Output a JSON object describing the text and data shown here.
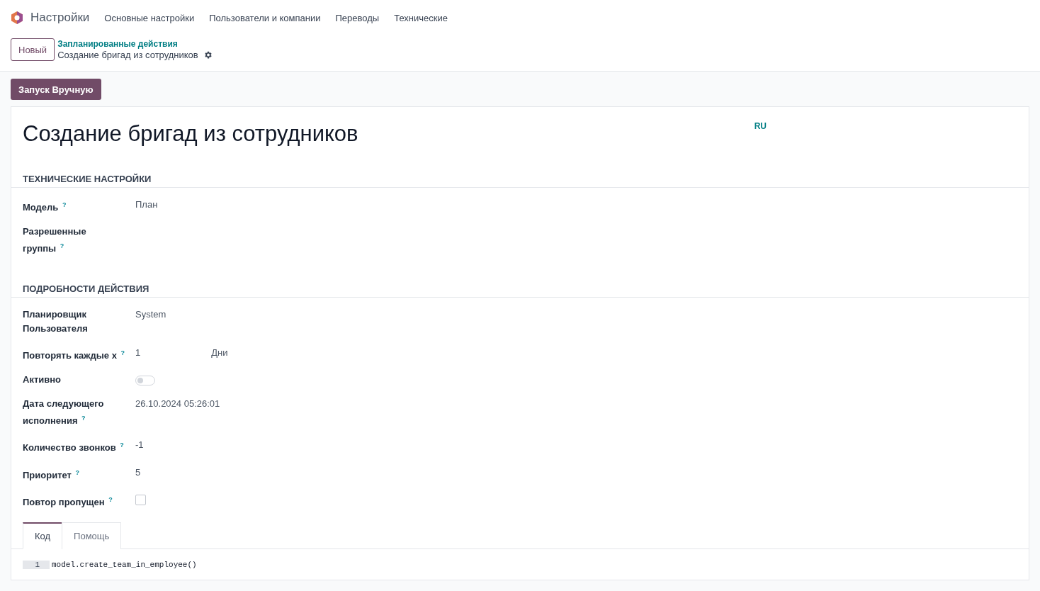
{
  "navbar": {
    "app_name": "Настройки",
    "menu": [
      "Основные настройки",
      "Пользователи и компании",
      "Переводы",
      "Технические"
    ]
  },
  "control_panel": {
    "new_button": "Новый",
    "breadcrumb": "Запланированные действия",
    "record_title": "Создание бригад из сотрудников"
  },
  "action_buttons": [
    "Запуск Вручную"
  ],
  "form": {
    "title": "Создание бригад из сотрудников",
    "language": "RU",
    "sections": [
      {
        "heading": "ТЕХНИЧЕСКИЕ НАСТРОЙКИ",
        "fields": [
          {
            "kind": "text",
            "label": "Модель $^{?}$",
            "value": "План"
          },
          {
            "kind": "text",
            "label": "Разрешенные\nгруппы $^{?}$"
          }
        ]
      },
      {
        "heading": "ПОДРОБНОСТИ ДЕЙСТВИЯ",
        "fields": [
          {
            "kind": "text",
            "label": "Планировщик\nПользователя",
            "value": "System"
          },
          {
            "kind": "interval",
            "label": "Повторять каждые х $^{?}$",
            "value": "1",
            "unit": "Дни"
          },
          {
            "kind": "toggle",
            "label": "Активно",
            "on": false
          },
          {
            "kind": "text",
            "label": "Дата следующего\nисполнения $^{?}$",
            "value": "26.10.2024 05:26:01"
          },
          {
            "kind": "text",
            "label": "Количество звонков $^{?}$",
            "value": "-1"
          },
          {
            "kind": "text",
            "label": "Приоритет $^{?}$",
            "value": "5"
          },
          {
            "kind": "checkbox",
            "label": "Повтор пропущен $^{?}$",
            "checked": false
          }
        ]
      }
    ],
    "tabs": [
      {
        "label": "Код",
        "selected": true
      },
      {
        "label": "Помощь",
        "selected": false
      }
    ],
    "code_lines": [
      {
        "number": "1",
        "text": "model.create_team_in_employee()"
      }
    ]
  }
}
